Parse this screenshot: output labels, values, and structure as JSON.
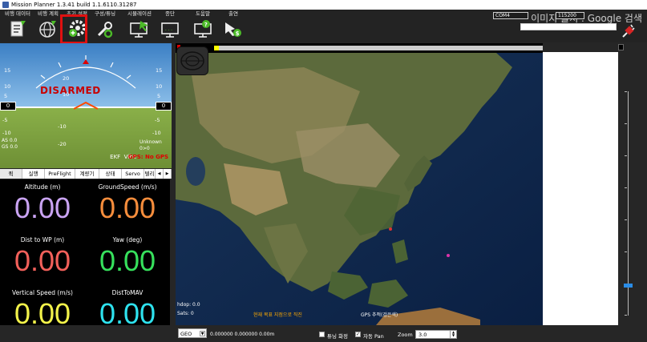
{
  "window": {
    "title": "Mission Planner 1.3.41 build 1.1.6110.31287"
  },
  "toolbar": {
    "items": [
      {
        "label": "비행 데이터",
        "icon": "flight-data-icon"
      },
      {
        "label": "비행 계획",
        "icon": "flight-plan-icon"
      },
      {
        "label": "초기 설정",
        "icon": "initial-setup-icon"
      },
      {
        "label": "구성/튜닝",
        "icon": "config-tuning-icon"
      },
      {
        "label": "시뮬레이션",
        "icon": "simulation-icon"
      },
      {
        "label": "종단",
        "icon": "terminal-icon"
      },
      {
        "label": "도움말",
        "icon": "help-icon"
      },
      {
        "label": "출연",
        "icon": "donate-icon"
      }
    ],
    "highlight_color": "#e01010"
  },
  "connection": {
    "port": "COM4",
    "baud": "115200",
    "extra": "",
    "connect_icon": "connect-plug-icon"
  },
  "watermark": "이미지 출처 : Google 검색",
  "hud": {
    "status": "DISARMED",
    "pitch_up": [
      "10",
      "20"
    ],
    "pitch_down": [
      "-10",
      "-20"
    ],
    "left_tape": [
      "15",
      "10",
      "5",
      "0",
      "-5",
      "-10"
    ],
    "left_value": "0",
    "right_tape": [
      "15",
      "10",
      "5",
      "0",
      "-5",
      "-10"
    ],
    "right_value": "0",
    "as_text": "AS 0.0",
    "gs_text": "GS 0.0",
    "mode": "Unknown",
    "mode_sub": "0>0",
    "ekf": "EKF",
    "vibe": "Vibe",
    "gps": "GPS: No GPS"
  },
  "tabs": [
    {
      "label": "퀵",
      "active": true
    },
    {
      "label": "실행"
    },
    {
      "label": "PreFlight"
    },
    {
      "label": "계량기"
    },
    {
      "label": "상태"
    },
    {
      "label": "Servo"
    },
    {
      "label": "텔리"
    }
  ],
  "quick": [
    {
      "label": "Altitude (m)",
      "value": "0.00",
      "color": "#c9a3f2"
    },
    {
      "label": "GroundSpeed (m/s)",
      "value": "0.00",
      "color": "#f58d3c"
    },
    {
      "label": "Dist to WP (m)",
      "value": "0.00",
      "color": "#f2605a"
    },
    {
      "label": "Yaw (deg)",
      "value": "0.00",
      "color": "#36e05c"
    },
    {
      "label": "Vertical Speed (m/s)",
      "value": "0.00",
      "color": "#f2f24a"
    },
    {
      "label": "DistToMAV",
      "value": "0.00",
      "color": "#2ee2ee"
    }
  ],
  "map": {
    "hdop": "hdop: 0.0",
    "sats": "Sats: 0",
    "sats_info": "",
    "legend_current": "현재 목표 지점으로 직진",
    "legend_home": "",
    "gps_track": "GPS 추적(검은색)"
  },
  "bottom": {
    "coord_system": "GEO",
    "coords": "0.000000  0.000000   0.00m",
    "tuning_label": "튜닝 화정",
    "autopan_label": "자동 Pan",
    "autopan_checked": true,
    "zoom_label": "Zoom",
    "zoom_value": "3.0"
  }
}
